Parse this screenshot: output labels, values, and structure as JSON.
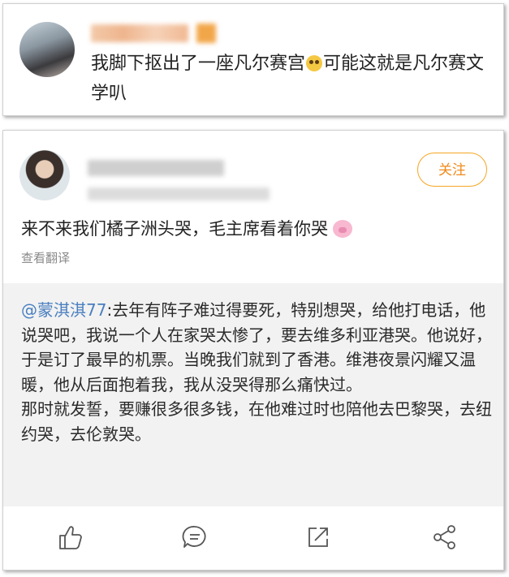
{
  "comment_card": {
    "text_part1": "我脚下抠出了一座凡尔赛宫",
    "text_part2": "可能这就是凡尔赛文学叭",
    "emoji_icon": "rolling-eyes-emoji-icon"
  },
  "post_card": {
    "follow_label": "关注",
    "post_text": "来不来我们橘子洲头哭，毛主席看着你哭",
    "post_emoji_icon": "pig-face-emoji-icon",
    "translate_label": "查看翻译",
    "quote": {
      "mention": "@蒙淇淇77",
      "text": ":去年有阵子难过得要死，特别想哭，给他打电话，他说哭吧，我说一个人在家哭太惨了，要去维多利亚港哭。他说好，于是订了最早的机票。当晚我们就到了香港。维港夜景闪耀又温暖，他从后面抱着我，我从没哭得那么痛快过。",
      "text2": "那时就发誓，要赚很多很多钱，在他难过时也陪他去巴黎哭，去纽约哭，去伦敦哭。"
    },
    "actions": [
      "like-icon",
      "comment-icon",
      "repost-icon",
      "share-icon"
    ]
  },
  "colors": {
    "accent_orange": "#f5a623",
    "mention_blue": "#4a7fc0",
    "quote_bg": "#f2f2f2",
    "secondary_text": "#8a8a8a"
  }
}
